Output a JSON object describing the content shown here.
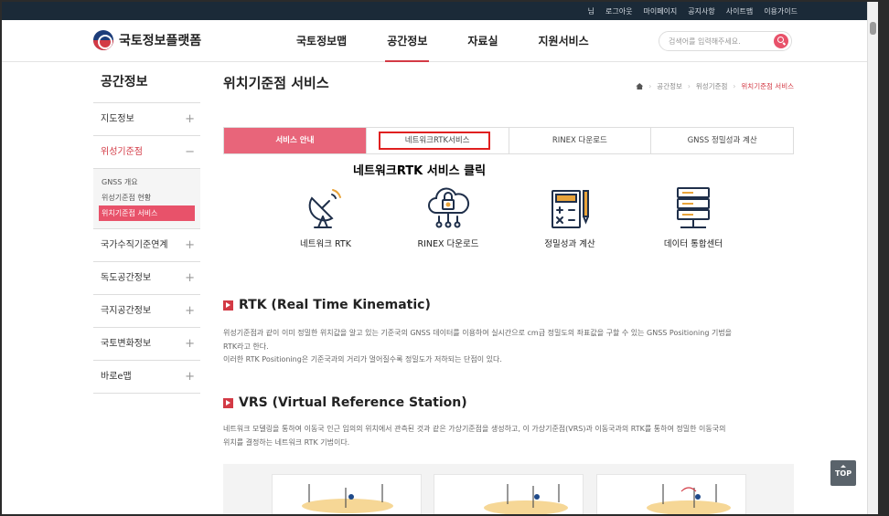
{
  "topbar": {
    "links": [
      "님",
      "로그아웃",
      "마이페이지",
      "공지사항",
      "사이트맵",
      "이용가이드"
    ]
  },
  "header": {
    "logo_text": "국토정보플랫폼",
    "nav": [
      "국토정보맵",
      "공간정보",
      "자료실",
      "지원서비스"
    ],
    "active_nav": "공간정보",
    "search_placeholder": "검색어를 입력해주세요."
  },
  "sidebar": {
    "title": "공간정보",
    "items": [
      {
        "label": "지도정보",
        "sign": "+"
      },
      {
        "label": "위성기준점",
        "sign": "−"
      },
      {
        "label": "국가수직기준연계",
        "sign": "+"
      },
      {
        "label": "독도공간정보",
        "sign": "+"
      },
      {
        "label": "극지공간정보",
        "sign": "+"
      },
      {
        "label": "국토변화정보",
        "sign": "+"
      },
      {
        "label": "바로e맵",
        "sign": "+"
      }
    ],
    "subitems": [
      "GNSS 개요",
      "위성기준점 현황",
      "위치기준점 서비스"
    ]
  },
  "main": {
    "title": "위치기준점 서비스",
    "breadcrumb": [
      "공간정보",
      "위성기준점",
      "위치기준점 서비스"
    ],
    "tabs": [
      "서비스 안내",
      "네트워크RTK서비스",
      "RINEX 다운로드",
      "GNSS 정밀성과 계산"
    ],
    "annotation": "네트워크RTK 서비스 클릭",
    "services": [
      "네트워크 RTK",
      "RINEX 다운로드",
      "정밀성과 계산",
      "데이터 통합센터"
    ],
    "sections": [
      {
        "title": "RTK (Real Time Kinematic)",
        "lines": [
          "위성기준점과 같이 이미 정밀한 위치값을 알고 있는 기준국의 GNSS 데이터를 이용하여 실시간으로 cm급 정밀도의 좌표값을 구할 수 있는 GNSS Positioning 기법을",
          "RTK라고 한다.",
          "이러한 RTK Positioning은 기준국과의 거리가 멀어질수록 정밀도가 저하되는 단점이 있다."
        ]
      },
      {
        "title": "VRS (Virtual Reference Station)",
        "lines": [
          "네트워크 모델링을 통하여 이동국 인근 임의의 위치에서 관측된 것과 같은 가상기준점을 생성하고, 이 가상기준점(VRS)과 이동국과의 RTK를 통하여 정밀한 이동국의",
          "위치를 결정하는 네트워크 RTK 기법이다."
        ]
      }
    ]
  },
  "top_button": "TOP",
  "colors": {
    "accent": "#d33a45",
    "tab_active": "#e8657a",
    "topbar": "#1b2a38",
    "icon_navy": "#1f2f4a",
    "icon_orange": "#e8a33a"
  }
}
